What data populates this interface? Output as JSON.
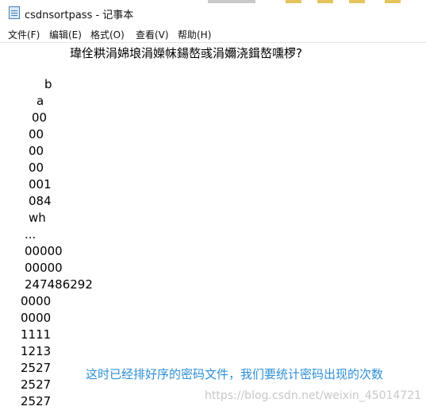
{
  "window": {
    "title": "csdnsortpass - 记事本"
  },
  "menu": {
    "items": [
      "文件(F)",
      "编辑(E)",
      "格式(O)",
      "查看(V)",
      "帮助(H)"
    ]
  },
  "editor": {
    "lines": [
      "瑋佺粠涓婂埌涓嬫帓鍚嶅彧涓嬭浇鍓嶅嚑椤?",
      "b",
      "a",
      "00",
      "00",
      "00",
      "00",
      "001",
      "084",
      "wh",
      "...",
      "00000",
      "00000",
      "247486292",
      "0000",
      "0000",
      "1111",
      "1213",
      "2527",
      "2527",
      "2527"
    ]
  },
  "annotation": "这时已经排好序的密码文件，我们要统计密码出现的次数",
  "watermark": "https://blog.csdn.net/weixin_45014721"
}
